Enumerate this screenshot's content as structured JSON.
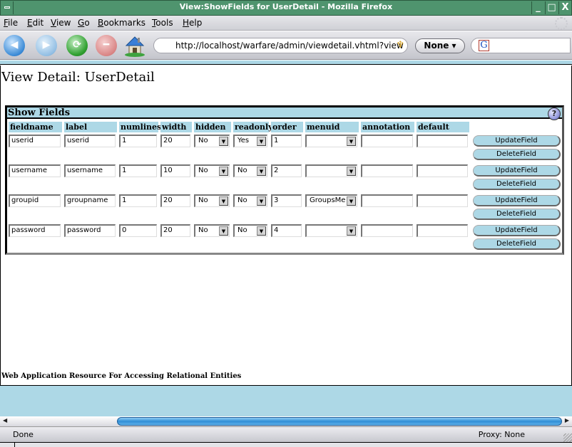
{
  "window": {
    "title": "View:ShowFields for UserDetail - Mozilla Firefox",
    "controls": {
      "minimize": "_",
      "maximize": "□",
      "close": "X"
    }
  },
  "menubar": {
    "items": [
      {
        "label": "File",
        "accel": "F",
        "rest": "ile"
      },
      {
        "label": "Edit",
        "accel": "E",
        "rest": "dit"
      },
      {
        "label": "View",
        "accel": "V",
        "rest": "iew"
      },
      {
        "label": "Go",
        "accel": "G",
        "rest": "o"
      },
      {
        "label": "Bookmarks",
        "accel": "B",
        "rest": "ookmarks"
      },
      {
        "label": "Tools",
        "accel": "T",
        "rest": "ools"
      },
      {
        "label": "Help",
        "accel": "H",
        "rest": "elp"
      }
    ]
  },
  "toolbar": {
    "back_icon": "back-arrow-icon",
    "forward_icon": "forward-arrow-icon",
    "reload_icon": "reload-icon",
    "stop_icon": "stop-icon",
    "home_icon": "home-icon",
    "url": "http://localhost/warfare/admin/viewdetail.vhtml?view",
    "proxy_button": "None ▾",
    "search_engine_glyph": "G",
    "search_value": ""
  },
  "page": {
    "title": "View Detail: UserDetail",
    "panel_title": "Show Fields",
    "help_glyph": "?",
    "columns": [
      "fieldname",
      "label",
      "numlines",
      "width",
      "hidden",
      "readonly",
      "order",
      "menuid",
      "annotation",
      "default"
    ],
    "rows": [
      {
        "fieldname": "userid",
        "label": "userid",
        "numlines": "1",
        "width": "20",
        "hidden": "No",
        "readonly": "Yes",
        "order": "1",
        "menuid": "",
        "annotation": "",
        "default": ""
      },
      {
        "fieldname": "username",
        "label": "username",
        "numlines": "1",
        "width": "10",
        "hidden": "No",
        "readonly": "No",
        "order": "2",
        "menuid": "",
        "annotation": "",
        "default": ""
      },
      {
        "fieldname": "groupid",
        "label": "groupname",
        "numlines": "1",
        "width": "20",
        "hidden": "No",
        "readonly": "No",
        "order": "3",
        "menuid": "GroupsMe",
        "annotation": "",
        "default": ""
      },
      {
        "fieldname": "password",
        "label": "password",
        "numlines": "0",
        "width": "20",
        "hidden": "No",
        "readonly": "No",
        "order": "4",
        "menuid": "",
        "annotation": "",
        "default": ""
      }
    ],
    "update_label": "UpdateField",
    "delete_label": "DeleteField",
    "footer": "Web Application Resource For Accessing Relational Entities"
  },
  "statusbar": {
    "status": "Done",
    "proxy": "Proxy: None"
  },
  "colors": {
    "titlebar": "#4f946e",
    "accent_blue": "#add8e6"
  }
}
